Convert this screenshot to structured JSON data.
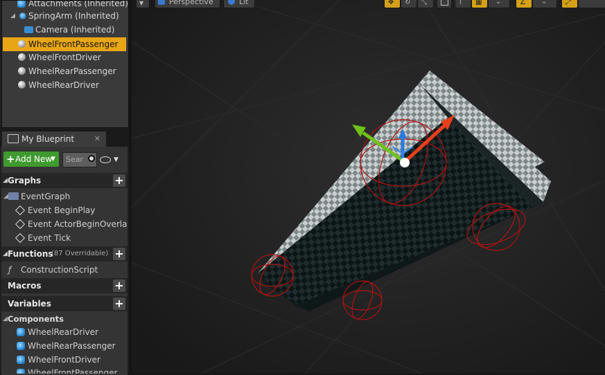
{
  "components_tree": {
    "items": [
      {
        "label": "Attachments (Inherited)",
        "icon": "blue-component-icon"
      },
      {
        "label": "SpringArm (Inherited)",
        "icon": "spring-arm-icon"
      },
      {
        "label": "Camera (Inherited)",
        "icon": "camera-icon"
      },
      {
        "label": "WheelFrontPassenger",
        "icon": "sphere-icon",
        "selected": true
      },
      {
        "label": "WheelFrontDriver",
        "icon": "sphere-icon"
      },
      {
        "label": "WheelRearPassenger",
        "icon": "sphere-icon"
      },
      {
        "label": "WheelRearDriver",
        "icon": "sphere-icon"
      }
    ]
  },
  "my_blueprint": {
    "tab_label": "My Blueprint",
    "add_new_label": "Add New",
    "search_placeholder": "Sear",
    "sections": {
      "graphs": {
        "title": "Graphs",
        "event_graph": "EventGraph",
        "events": [
          "Event BeginPlay",
          "Event ActorBeginOverla",
          "Event Tick"
        ]
      },
      "functions": {
        "title": "Functions",
        "overridable": "(87 Overridable)",
        "items": [
          "ConstructionScript"
        ]
      },
      "macros": {
        "title": "Macros"
      },
      "variables": {
        "title": "Variables",
        "components_title": "Components",
        "components": [
          "WheelRearDriver",
          "WheelRearPassenger",
          "WheelFrontDriver",
          "WheelFrontPassenger"
        ]
      }
    }
  },
  "viewport": {
    "toolbar": {
      "perspective_label": "Perspective",
      "lit_label": "Lit"
    }
  },
  "colors": {
    "selection": "#e8a616",
    "add_new": "#3f9a2f",
    "gizmo_x": "#e8401c",
    "gizmo_y": "#6fc21a",
    "gizmo_z": "#2a7ae0"
  }
}
